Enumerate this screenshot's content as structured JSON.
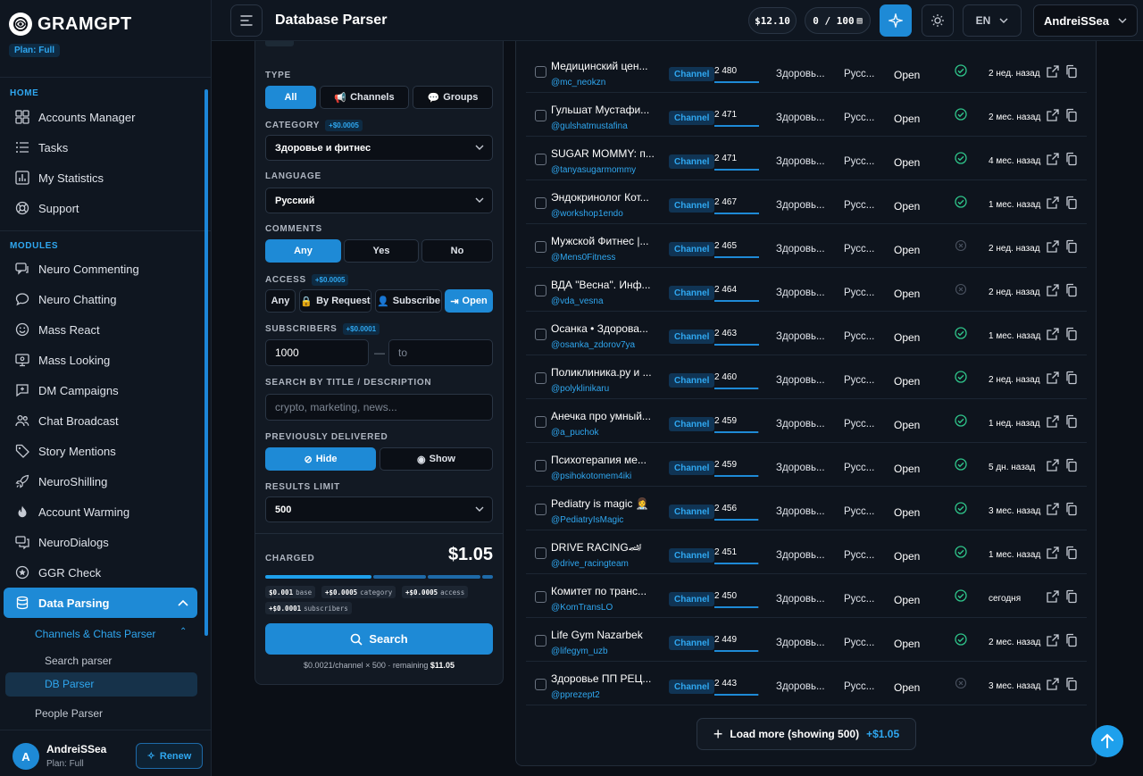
{
  "brand": {
    "name": "GRAMGPT",
    "plan_badge": "Plan: Full"
  },
  "sidebar": {
    "sections": {
      "home": "HOME",
      "modules": "MODULES"
    },
    "home_items": [
      {
        "label": "Accounts Manager",
        "icon": "accounts-grid-icon"
      },
      {
        "label": "Tasks",
        "icon": "list-icon"
      },
      {
        "label": "My Statistics",
        "icon": "bar-chart-icon"
      },
      {
        "label": "Support",
        "icon": "lifebuoy-icon"
      }
    ],
    "module_items": [
      {
        "label": "Neuro Commenting",
        "icon": "comments-icon"
      },
      {
        "label": "Neuro Chatting",
        "icon": "chat-bubble-icon"
      },
      {
        "label": "Mass React",
        "icon": "smile-icon"
      },
      {
        "label": "Mass Looking",
        "icon": "monitor-eye-icon"
      },
      {
        "label": "DM Campaigns",
        "icon": "message-plus-icon"
      },
      {
        "label": "Chat Broadcast",
        "icon": "users-icon"
      },
      {
        "label": "Story Mentions",
        "icon": "tag-icon"
      },
      {
        "label": "NeuroShilling",
        "icon": "rocket-icon"
      },
      {
        "label": "Account Warming",
        "icon": "flame-icon"
      },
      {
        "label": "NeuroDialogs",
        "icon": "dialogs-icon"
      },
      {
        "label": "GGR Check",
        "icon": "star-badge-icon"
      },
      {
        "label": "Data Parsing",
        "icon": "database-icon"
      }
    ],
    "sub": {
      "group": "Channels & Chats Parser",
      "search": "Search parser",
      "db": "DB Parser",
      "people": "People Parser"
    },
    "footer": {
      "avatar": "A",
      "name": "AndreiSSea",
      "plan": "Plan: Full",
      "renew": "Renew"
    }
  },
  "topbar": {
    "title": "Database Parser",
    "balance": "$12.10",
    "counter": "0 / 100",
    "lang": "EN",
    "user": "AndreiSSea"
  },
  "filters": {
    "type": {
      "label": "TYPE",
      "options": [
        "All",
        "Channels",
        "Groups"
      ],
      "selected": "All"
    },
    "category": {
      "label": "CATEGORY",
      "tag": "+$0.0005",
      "value": "Здоровье и фитнес"
    },
    "language": {
      "label": "LANGUAGE",
      "value": "Русский"
    },
    "comments": {
      "label": "COMMENTS",
      "options": [
        "Any",
        "Yes",
        "No"
      ],
      "selected": "Any"
    },
    "access": {
      "label": "ACCESS",
      "tag": "+$0.0005",
      "options": [
        "Any",
        "By Request",
        "Subscribe",
        "Open"
      ],
      "selected": "Open"
    },
    "subscribers": {
      "label": "SUBSCRIBERS",
      "tag": "+$0.0001",
      "from": "1000",
      "to_placeholder": "to"
    },
    "search": {
      "label": "SEARCH BY TITLE / DESCRIPTION",
      "placeholder": "crypto, marketing, news..."
    },
    "delivered": {
      "label": "PREVIOUSLY DELIVERED",
      "options": [
        "Hide",
        "Show"
      ],
      "selected": "Hide"
    },
    "limit": {
      "label": "RESULTS LIMIT",
      "value": "500"
    }
  },
  "charged": {
    "label": "CHARGED",
    "amount": "$1.05",
    "chips": [
      {
        "amount": "$0.001",
        "label": "base"
      },
      {
        "amount": "+$0.0005",
        "label": "category"
      },
      {
        "amount": "+$0.0005",
        "label": "access"
      },
      {
        "amount": "+$0.0001",
        "label": "subscribers"
      }
    ],
    "search_button": "Search",
    "cost_line": "$0.0021/channel × 500 · remaining",
    "remaining": "$11.05"
  },
  "results": {
    "rows": [
      {
        "title": "Медицинский цен...",
        "handle": "@mc_neokzn",
        "type": "Channel",
        "subs": "2 480",
        "cat": "Здоровь...",
        "lang": "Русс...",
        "access": "Open",
        "status": "ok",
        "time": "2 нед. назад"
      },
      {
        "title": "Гульшат Мустафи...",
        "handle": "@gulshatmustafina",
        "type": "Channel",
        "subs": "2 471",
        "cat": "Здоровь...",
        "lang": "Русс...",
        "access": "Open",
        "status": "ok",
        "time": "2 мес. назад"
      },
      {
        "title": "SUGAR MOMMY: п...",
        "handle": "@tanyasugarmommy",
        "type": "Channel",
        "subs": "2 471",
        "cat": "Здоровь...",
        "lang": "Русс...",
        "access": "Open",
        "status": "ok",
        "time": "4 мес. назад"
      },
      {
        "title": "Эндокринолог Кот...",
        "handle": "@workshop1endo",
        "type": "Channel",
        "subs": "2 467",
        "cat": "Здоровь...",
        "lang": "Русс...",
        "access": "Open",
        "status": "ok",
        "time": "1 мес. назад"
      },
      {
        "title": "Мужской Фитнес |...",
        "handle": "@Mens0Fitness",
        "type": "Channel",
        "subs": "2 465",
        "cat": "Здоровь...",
        "lang": "Русс...",
        "access": "Open",
        "status": "none",
        "time": "2 нед. назад"
      },
      {
        "title": "ВДА \"Весна\". Инф...",
        "handle": "@vda_vesna",
        "type": "Channel",
        "subs": "2 464",
        "cat": "Здоровь...",
        "lang": "Русс...",
        "access": "Open",
        "status": "none",
        "time": "2 нед. назад"
      },
      {
        "title": "Осанка • Здорова...",
        "handle": "@osanka_zdorov7ya",
        "type": "Channel",
        "subs": "2 463",
        "cat": "Здоровь...",
        "lang": "Русс...",
        "access": "Open",
        "status": "ok",
        "time": "1 мес. назад"
      },
      {
        "title": "Поликлиника.ру и ...",
        "handle": "@polyklinikaru",
        "type": "Channel",
        "subs": "2 460",
        "cat": "Здоровь...",
        "lang": "Русс...",
        "access": "Open",
        "status": "ok",
        "time": "2 нед. назад"
      },
      {
        "title": "Анечка про умный...",
        "handle": "@a_puchok",
        "type": "Channel",
        "subs": "2 459",
        "cat": "Здоровь...",
        "lang": "Русс...",
        "access": "Open",
        "status": "ok",
        "time": "1 нед. назад"
      },
      {
        "title": "Психотерапия ме...",
        "handle": "@psihokotomem4iki",
        "type": "Channel",
        "subs": "2 459",
        "cat": "Здоровь...",
        "lang": "Русс...",
        "access": "Open",
        "status": "ok",
        "time": "5 дн. назад"
      },
      {
        "title": "Pediatry is magic 👩‍⚕️",
        "handle": "@PediatryIsMagic",
        "type": "Channel",
        "subs": "2 456",
        "cat": "Здоровь...",
        "lang": "Русс...",
        "access": "Open",
        "status": "ok",
        "time": "3 мес. назад"
      },
      {
        "title": "DRIVE RACING🏎",
        "handle": "@drive_racingteam",
        "type": "Channel",
        "subs": "2 451",
        "cat": "Здоровь...",
        "lang": "Русс...",
        "access": "Open",
        "status": "ok",
        "time": "1 мес. назад"
      },
      {
        "title": "Комитет по транс...",
        "handle": "@KomTransLO",
        "type": "Channel",
        "subs": "2 450",
        "cat": "Здоровь...",
        "lang": "Русс...",
        "access": "Open",
        "status": "ok",
        "time": "сегодня"
      },
      {
        "title": "Life Gym Nazarbek",
        "handle": "@lifegym_uzb",
        "type": "Channel",
        "subs": "2 449",
        "cat": "Здоровь...",
        "lang": "Русс...",
        "access": "Open",
        "status": "ok",
        "time": "2 мес. назад"
      },
      {
        "title": "Здоровье ПП РЕЦ...",
        "handle": "@pprezept2",
        "type": "Channel",
        "subs": "2 443",
        "cat": "Здоровь...",
        "lang": "Русс...",
        "access": "Open",
        "status": "none",
        "time": "3 мес. назад"
      }
    ],
    "load_more": "Load more (showing 500)",
    "load_more_price": "+$1.05"
  },
  "colors": {
    "accent": "#1e8ad6",
    "ok": "#2fc48a",
    "bg": "#0b0f16"
  }
}
